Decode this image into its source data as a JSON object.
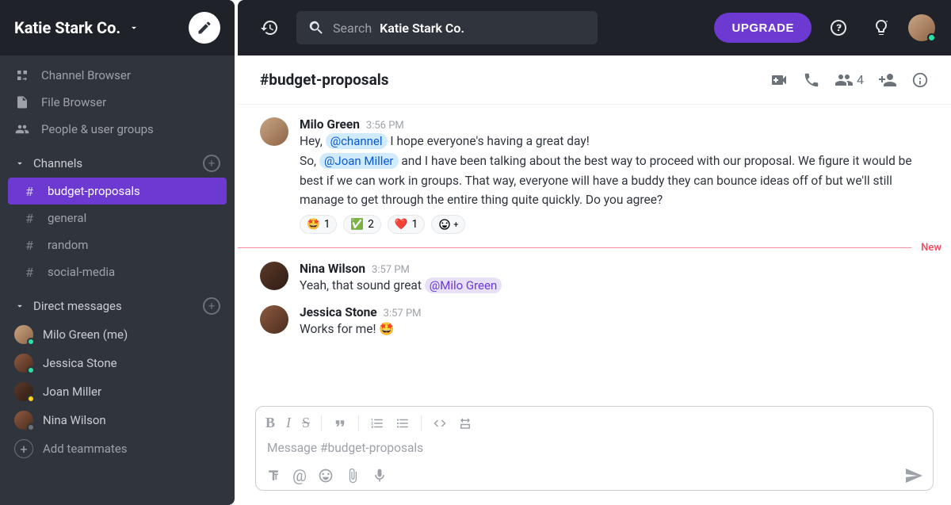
{
  "workspace": {
    "name": "Katie Stark Co."
  },
  "sidebar": {
    "browser_items": [
      {
        "label": "Channel Browser"
      },
      {
        "label": "File Browser"
      },
      {
        "label": "People & user groups"
      }
    ],
    "channels_title": "Channels",
    "channels": [
      {
        "label": "budget-proposals",
        "active": true
      },
      {
        "label": "general",
        "active": false
      },
      {
        "label": "random",
        "active": false
      },
      {
        "label": "social-media",
        "active": false
      }
    ],
    "dm_title": "Direct messages",
    "dms": [
      {
        "label": "Milo Green (me)",
        "presence": "online"
      },
      {
        "label": "Jessica Stone",
        "presence": "online"
      },
      {
        "label": "Joan Miller",
        "presence": "away"
      },
      {
        "label": "Nina Wilson",
        "presence": "offline"
      }
    ],
    "add_teammates": "Add teammates"
  },
  "topbar": {
    "search_label": "Search",
    "search_workspace": "Katie Stark Co.",
    "upgrade": "UPGRADE"
  },
  "channel_header": {
    "title": "#budget-proposals",
    "member_count": "4"
  },
  "messages": [
    {
      "user": "Milo Green",
      "time": "3:56 PM",
      "line1_pre": "Hey, ",
      "mention1": "@channel",
      "line1_post": " I hope everyone's having a great day!",
      "line2_pre": "So, ",
      "mention2": "@Joan Miller",
      "line2_post": " and I have been talking about the best way to proceed with our proposal. We figure it would be best if we can work in groups. That way, everyone will have a buddy they can bounce ideas off of but  we'll still manage to get through the entire thing quite quickly. Do you agree?",
      "reactions": [
        {
          "emoji": "🤩",
          "count": "1"
        },
        {
          "emoji": "✅",
          "count": "2"
        },
        {
          "emoji": "❤️",
          "count": "1"
        }
      ]
    },
    {
      "user": "Nina Wilson",
      "time": "3:57 PM",
      "line1_pre": "Yeah, that sound great ",
      "mention1": "@Milo Green"
    },
    {
      "user": "Jessica Stone",
      "time": "3:57 PM",
      "line1_pre": "Works for me! ",
      "emoji_suffix": "🤩"
    }
  ],
  "divider": {
    "label": "New"
  },
  "composer": {
    "placeholder": "Message #budget-proposals"
  }
}
